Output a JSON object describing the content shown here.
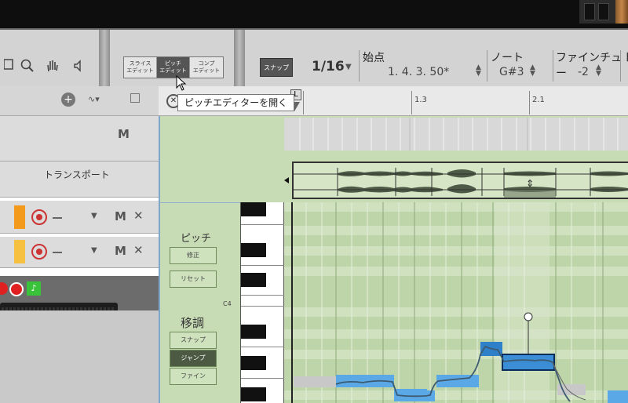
{
  "toolbar": {
    "tools": [
      "keyboard-icon",
      "zoom-icon",
      "hand-icon",
      "speaker-icon"
    ],
    "edit_modes": [
      {
        "label": "スライス\nエディット",
        "active": false
      },
      {
        "label": "ピッチ\nエディット",
        "active": true
      },
      {
        "label": "コンプ\nエディット",
        "active": false
      }
    ],
    "snap_label": "スナップ",
    "quantize_value": "1/16",
    "start_label": "始点",
    "start_value": "1. 4. 3. 50*",
    "note_label": "ノート",
    "note_value": "G#3",
    "fine_label": "ファインチュー",
    "fine_value": "-2",
    "extra_label": "ト"
  },
  "tooltip": "ピッチエディターを開く",
  "tracks": {
    "header_m": "M",
    "transport_label": "トランスポート",
    "rows": [
      {
        "color": "#f39a1c",
        "m": "M",
        "x": "✕"
      },
      {
        "color": "#f6c040",
        "m": "M",
        "x": "✕"
      }
    ]
  },
  "ruler": {
    "marks": [
      "1.3",
      "2.1"
    ],
    "locator": "L"
  },
  "pitch_panel": {
    "pitch_title": "ピッチ",
    "correct_label": "修正",
    "reset_label": "リセット",
    "transpose_title": "移調",
    "snap_label": "スナップ",
    "jump_label": "ジャンプ",
    "fine_label": "ファイン",
    "note_c4": "C4"
  },
  "colors": {
    "accent_blue": "#5aa9e6",
    "grid_green": "#bed4a9",
    "orange_track": "#f39a1c",
    "yellow_track": "#f6c040"
  }
}
